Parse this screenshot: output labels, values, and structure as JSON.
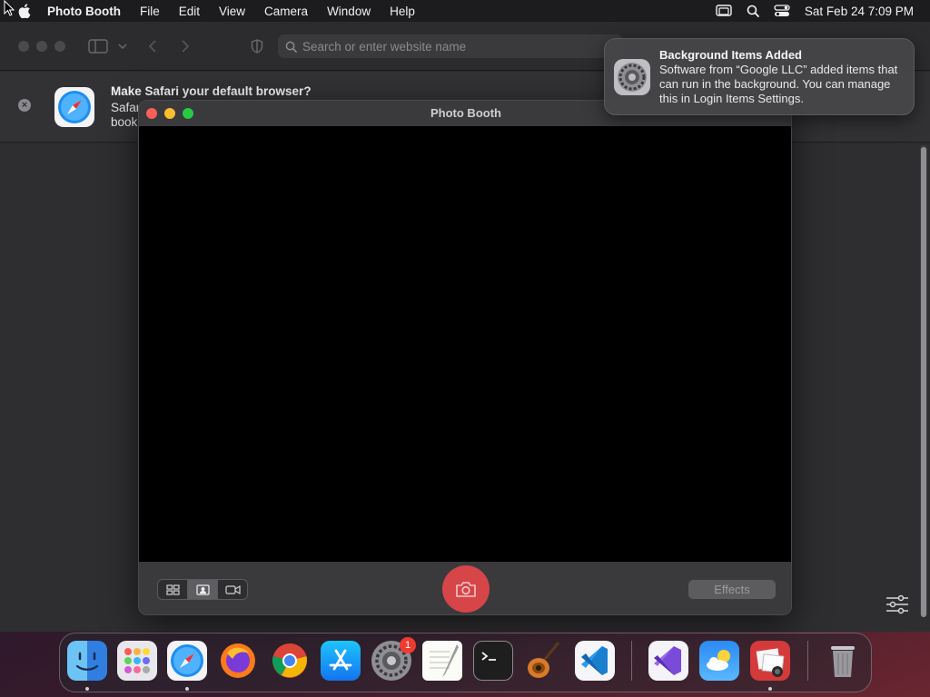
{
  "menubar": {
    "app_name": "Photo Booth",
    "items": [
      "File",
      "Edit",
      "View",
      "Camera",
      "Window",
      "Help"
    ],
    "clock": "Sat Feb 24  7:09 PM"
  },
  "safari": {
    "address_placeholder": "Search or enter website name",
    "banner": {
      "title": "Make Safari your default browser?",
      "line1": "Safari",
      "line2": "bookmarks"
    }
  },
  "photo_booth": {
    "title": "Photo Booth",
    "effects_label": "Effects"
  },
  "notification": {
    "title": "Background Items Added",
    "body": "Software from “Google LLC” added items that can run in the background. You can manage this in Login Items Settings."
  },
  "dock": {
    "apps": [
      "Finder",
      "Launchpad",
      "Safari",
      "Firefox",
      "Google Chrome",
      "App Store",
      "System Settings",
      "TextEdit",
      "Terminal",
      "GarageBand",
      "Visual Studio Code",
      "Visual Studio",
      "Weather",
      "Photo Booth",
      "Trash"
    ],
    "system_settings_badge": "1"
  }
}
